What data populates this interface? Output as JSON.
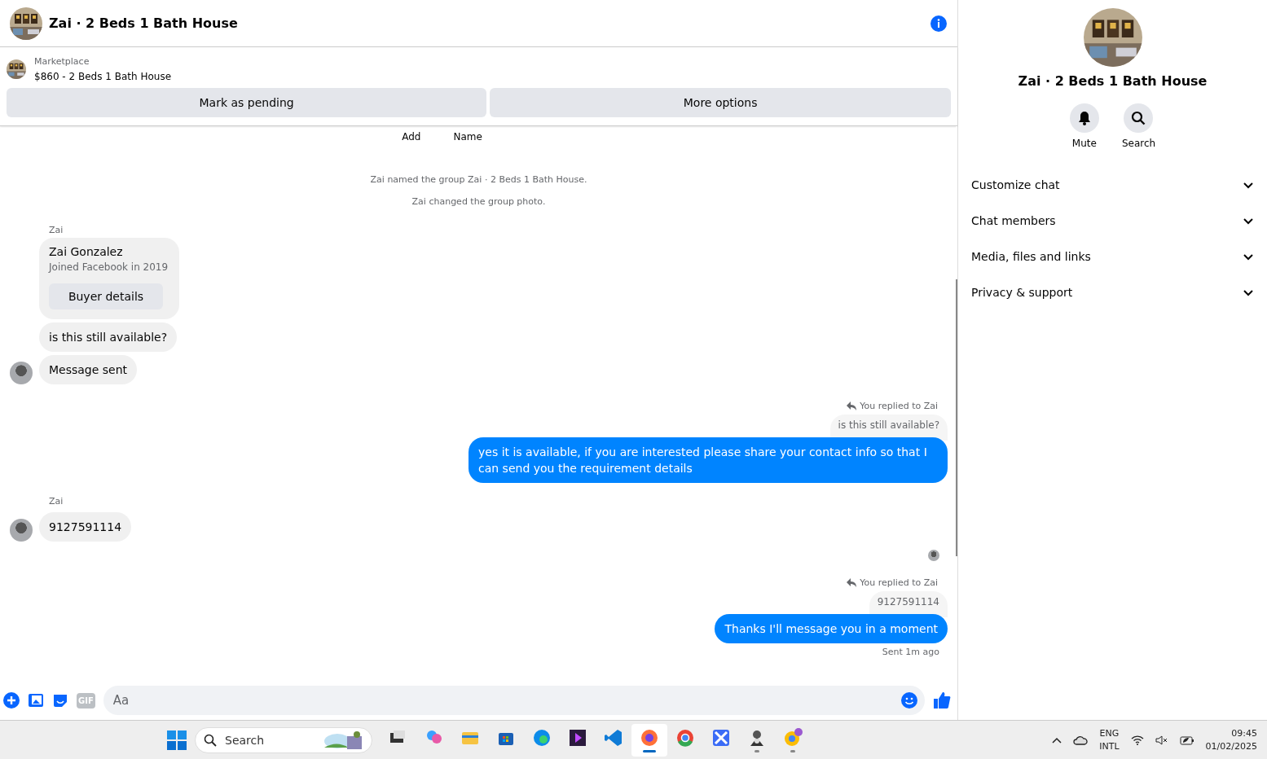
{
  "header": {
    "title": "Zai · 2 Beds 1 Bath House"
  },
  "listing": {
    "source": "Marketplace",
    "title": "$860 - 2 Beds 1 Bath House"
  },
  "actions": [
    "Mark as pending",
    "More options"
  ],
  "top_actions": [
    "Add",
    "Name"
  ],
  "messages": [
    {
      "kind": "system",
      "text": "Zai named the group Zai · 2 Beds 1 Bath House."
    },
    {
      "kind": "system",
      "text": "Zai changed the group photo."
    },
    {
      "kind": "sender",
      "text": "Zai"
    },
    {
      "kind": "card",
      "name": "Zai Gonzalez",
      "subtitle": "Joined Facebook in 2019",
      "button": "Buyer details"
    },
    {
      "kind": "incoming",
      "text": "is this still available?",
      "avatar": false
    },
    {
      "kind": "incoming",
      "text": "Message sent",
      "avatar": true
    },
    {
      "kind": "reply_label",
      "text": "You replied to Zai"
    },
    {
      "kind": "quote",
      "text": "is this still available?"
    },
    {
      "kind": "outgoing",
      "text": "yes it is available, if you are interested please share your contact info so that I can send you the requirement details"
    },
    {
      "kind": "sender",
      "text": "Zai"
    },
    {
      "kind": "incoming",
      "text": "9127591114",
      "avatar": true
    },
    {
      "kind": "seen"
    },
    {
      "kind": "reply_label",
      "text": "You replied to Zai"
    },
    {
      "kind": "quote",
      "text": "9127591114"
    },
    {
      "kind": "outgoing",
      "text": "Thanks I'll message you in a moment"
    },
    {
      "kind": "status",
      "text": "Sent 1m ago"
    }
  ],
  "composer": {
    "placeholder": "Aa",
    "gif": "GIF"
  },
  "details": {
    "title": "Zai · 2 Beds 1 Bath House",
    "buttons": [
      "Mute",
      "Search"
    ],
    "sections": [
      {
        "label": "Customize chat",
        "expanded": false
      },
      {
        "label": "Chat members",
        "expanded": false
      },
      {
        "label": "Media, files and links",
        "expanded": false
      },
      {
        "label": "Privacy & support",
        "expanded": false
      }
    ]
  },
  "taskbar": {
    "search": "Search",
    "apps": [
      {
        "running": false,
        "selected": false
      },
      {
        "running": false,
        "selected": false
      },
      {
        "running": false,
        "selected": false
      },
      {
        "running": false,
        "selected": false
      },
      {
        "running": false,
        "selected": false
      },
      {
        "running": false,
        "selected": false
      },
      {
        "running": false,
        "selected": false
      },
      {
        "running": true,
        "selected": true
      },
      {
        "running": false,
        "selected": false
      },
      {
        "running": false,
        "selected": false
      },
      {
        "running": true,
        "selected": false
      },
      {
        "running": true,
        "selected": false
      }
    ],
    "language": [
      "ENG",
      "INTL"
    ],
    "time": "09:45",
    "date": "01/02/2025"
  }
}
